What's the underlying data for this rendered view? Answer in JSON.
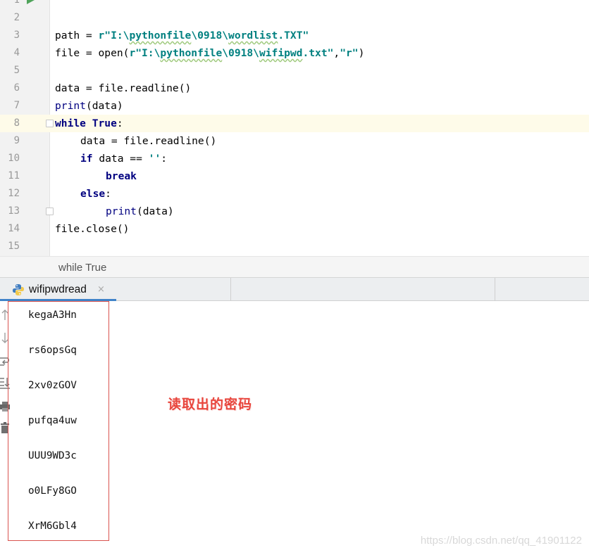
{
  "editor": {
    "lines": [
      {
        "num": "1",
        "run_marker": true,
        "parts": []
      },
      {
        "num": "2",
        "parts": []
      },
      {
        "num": "3",
        "indent": 0,
        "parts": [
          {
            "t": "path = "
          },
          {
            "t": "r\"I:\\",
            "c": "str"
          },
          {
            "t": "pythonfile",
            "c": "str wavy"
          },
          {
            "t": "\\0918\\",
            "c": "str"
          },
          {
            "t": "wordlist",
            "c": "str wavy"
          },
          {
            "t": ".TXT\"",
            "c": "str"
          }
        ]
      },
      {
        "num": "4",
        "indent": 0,
        "parts": [
          {
            "t": "file = open("
          },
          {
            "t": "r\"I:\\",
            "c": "str"
          },
          {
            "t": "pythonfile",
            "c": "str wavy"
          },
          {
            "t": "\\0918\\",
            "c": "str"
          },
          {
            "t": "wifipwd",
            "c": "str wavy"
          },
          {
            "t": ".txt\"",
            "c": "str"
          },
          {
            "t": ","
          },
          {
            "t": "\"r\"",
            "c": "str"
          },
          {
            "t": ")"
          }
        ]
      },
      {
        "num": "5",
        "parts": []
      },
      {
        "num": "6",
        "indent": 0,
        "parts": [
          {
            "t": "data = file.readline()"
          }
        ]
      },
      {
        "num": "7",
        "indent": 0,
        "parts": [
          {
            "t": "print",
            "c": "kw-normal"
          },
          {
            "t": "(data)"
          }
        ]
      },
      {
        "num": "8",
        "indent": 0,
        "current": true,
        "fold": true,
        "parts": [
          {
            "t": "while ",
            "c": "kw"
          },
          {
            "t": "True",
            "c": "kw"
          },
          {
            "t": ":"
          }
        ]
      },
      {
        "num": "9",
        "indent": 1,
        "parts": [
          {
            "t": "data = file.readline()"
          }
        ]
      },
      {
        "num": "10",
        "indent": 1,
        "parts": [
          {
            "t": "if ",
            "c": "kw"
          },
          {
            "t": "data == "
          },
          {
            "t": "''",
            "c": "str"
          },
          {
            "t": ":"
          }
        ]
      },
      {
        "num": "11",
        "indent": 2,
        "parts": [
          {
            "t": "break",
            "c": "kw"
          }
        ]
      },
      {
        "num": "12",
        "indent": 1,
        "parts": [
          {
            "t": "else",
            "c": "kw"
          },
          {
            "t": ":"
          }
        ]
      },
      {
        "num": "13",
        "indent": 2,
        "fold": true,
        "parts": [
          {
            "t": "print",
            "c": "kw-normal"
          },
          {
            "t": "(data)"
          }
        ]
      },
      {
        "num": "14",
        "indent": 0,
        "parts": [
          {
            "t": "file.close()"
          }
        ]
      },
      {
        "num": "15",
        "parts": []
      }
    ]
  },
  "breadcrumb": {
    "text": "while True"
  },
  "run_panel": {
    "tab_label": "wifipwdread",
    "tab_close_glyph": "×",
    "toolbar_icons": [
      "up-arrow-icon",
      "down-arrow-icon",
      "soft-wrap-icon",
      "scroll-to-end-icon",
      "print-icon",
      "trash-icon"
    ],
    "output_lines": [
      "kegaA3Hn",
      "rs6opsGq",
      "2xv0zGOV",
      "pufqa4uw",
      "UUU9WD3c",
      "o0LFy8GO",
      "XrM6Gbl4"
    ]
  },
  "annotation": {
    "text": "读取出的密码",
    "color": "#e8453c"
  },
  "watermark": {
    "text": "https://blog.csdn.net/qq_41901122"
  },
  "colors": {
    "keyword": "#000080",
    "string": "#008080",
    "run_arrow": "#4fa35a",
    "current_line": "#fefbe9",
    "tab_accent": "#4083c9",
    "highlight_box": "#d9534f"
  }
}
